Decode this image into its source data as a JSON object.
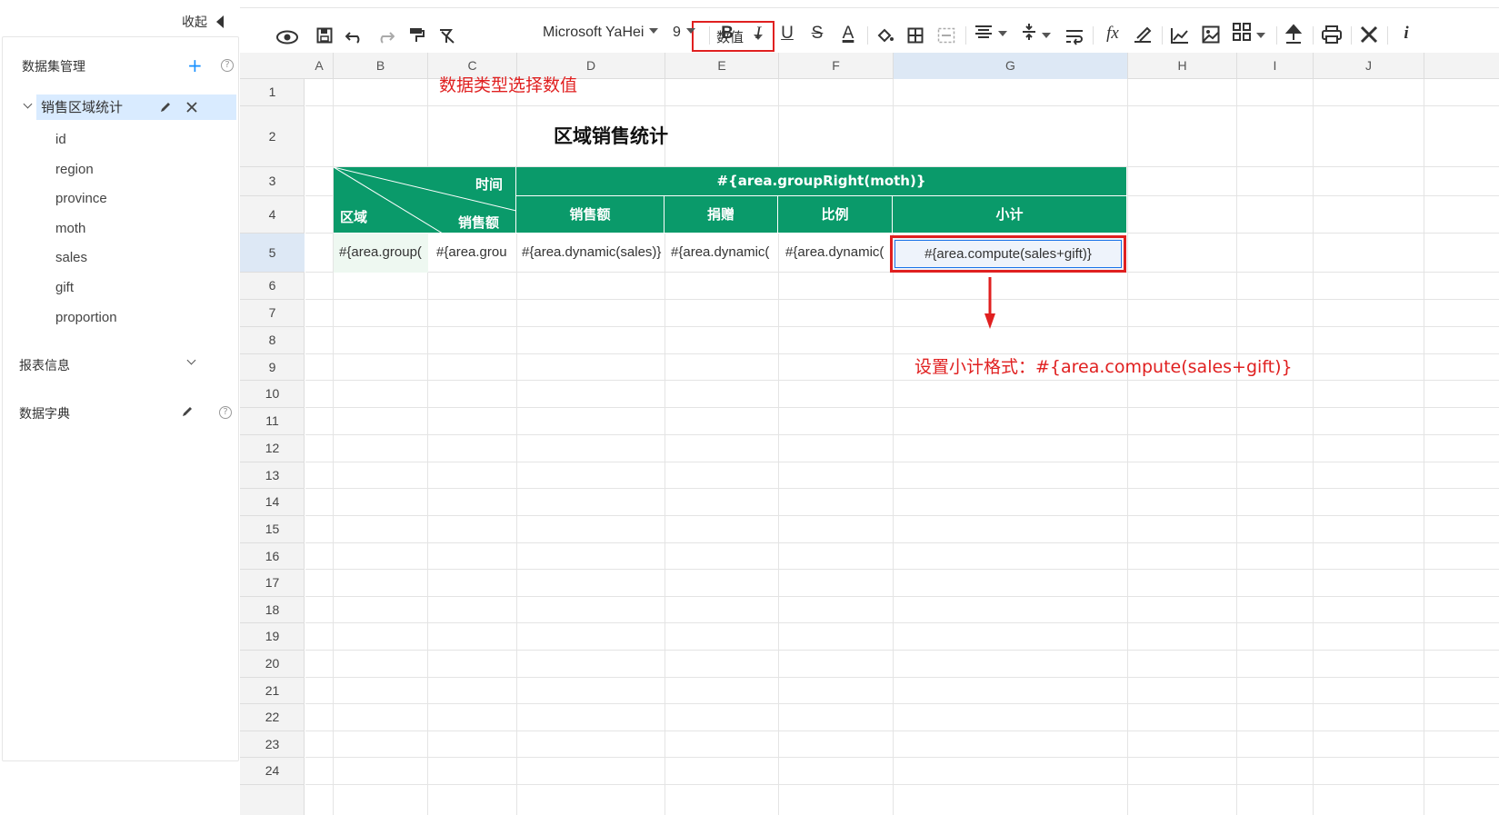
{
  "sidebar": {
    "collapse_label": "收起",
    "dataset_title": "数据集管理",
    "dataset_add": "+",
    "help_glyph": "?",
    "dataset_name": "销售区域统计",
    "fields": [
      "id",
      "region",
      "province",
      "moth",
      "sales",
      "gift",
      "proportion"
    ],
    "report_info": "报表信息",
    "dictionary": "数据字典"
  },
  "toolbar": {
    "data_type": "数值",
    "font_family": "Microsoft YaHei",
    "font_size": "9",
    "bold": "B",
    "italic": "I",
    "underline": "U",
    "strike": "S",
    "font_color": "A",
    "formula": "fx",
    "info": "i"
  },
  "grid": {
    "columns": [
      "A",
      "B",
      "C",
      "D",
      "E",
      "F",
      "G",
      "H",
      "I",
      "J"
    ],
    "rows": [
      "1",
      "2",
      "3",
      "4",
      "5",
      "6",
      "7",
      "8",
      "9",
      "10",
      "11",
      "12",
      "13",
      "14",
      "15",
      "16",
      "17",
      "18",
      "19",
      "20",
      "21",
      "22",
      "23",
      "24"
    ],
    "selected_column": "G",
    "selected_row": "5"
  },
  "report": {
    "title": "区域销售统计",
    "diag_time": "时间",
    "diag_region": "区域",
    "diag_sales": "销售额",
    "group_right": "#{area.groupRight(moth)}",
    "h_sales": "销售额",
    "h_gift": "捐赠",
    "h_ratio": "比例",
    "h_subtotal": "小计",
    "c_b5": "#{area.group(",
    "c_c5": "#{area.grou",
    "c_d5": "#{area.dynamic(sales)}",
    "c_e5": "#{area.dynamic(",
    "c_f5": "#{area.dynamic(",
    "c_g5": "#{area.compute(sales+gift)}"
  },
  "annotations": {
    "type_note": "数据类型选择数值",
    "subtotal_note": "设置小计格式：#{area.compute(sales+gift)}"
  }
}
